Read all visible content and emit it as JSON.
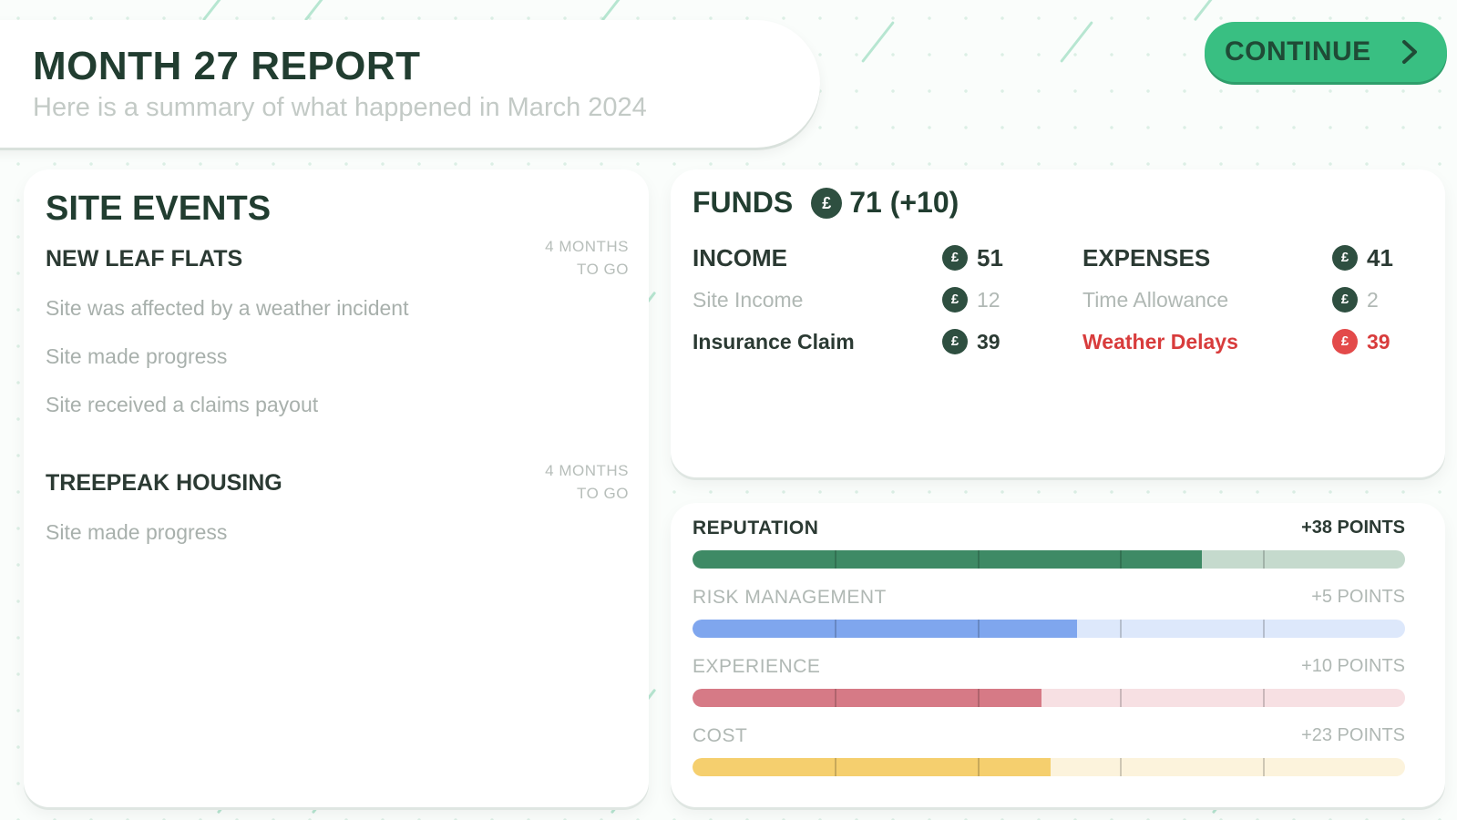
{
  "header": {
    "title": "MONTH 27 REPORT",
    "subtitle": "Here is a summary of what happened in March 2024"
  },
  "continue_button": {
    "label": "CONTINUE",
    "icon": "chevron-right-icon"
  },
  "site_events": {
    "title": "SITE EVENTS",
    "sites": [
      {
        "name": "NEW LEAF FLATS",
        "remaining_line1": "4 MONTHS",
        "remaining_line2": "TO GO",
        "events": [
          "Site was affected by a weather incident",
          "Site made progress",
          "Site received a claims payout"
        ]
      },
      {
        "name": "TREEPEAK HOUSING",
        "remaining_line1": "4 MONTHS",
        "remaining_line2": "TO GO",
        "events": [
          "Site made progress"
        ]
      }
    ]
  },
  "funds": {
    "label": "FUNDS",
    "coin_symbol": "£",
    "total": "71 (+10)",
    "income": {
      "label": "INCOME",
      "total": "51",
      "items": [
        {
          "label": "Site Income",
          "amount": "12"
        },
        {
          "label": "Insurance Claim",
          "amount": "39"
        }
      ]
    },
    "expenses": {
      "label": "EXPENSES",
      "total": "41",
      "items": [
        {
          "label": "Time Allowance",
          "amount": "2"
        },
        {
          "label": "Weather Delays",
          "amount": "39"
        }
      ]
    }
  },
  "stats": [
    {
      "name": "REPUTATION",
      "points": "+38 POINTS",
      "fill": 0.715,
      "color": "#3e8a65",
      "track": "#c5dacd",
      "emphasis": true
    },
    {
      "name": "RISK MANAGEMENT",
      "points": "+5 POINTS",
      "fill": 0.54,
      "color": "#7fa6ee",
      "track": "#dde8fb",
      "emphasis": false
    },
    {
      "name": "EXPERIENCE",
      "points": "+10 POINTS",
      "fill": 0.49,
      "color": "#d67a86",
      "track": "#f7e0e3",
      "emphasis": false
    },
    {
      "name": "COST",
      "points": "+23 POINTS",
      "fill": 0.503,
      "color": "#f5cf6e",
      "track": "#fcf3dc",
      "emphasis": false
    }
  ],
  "colors": {
    "accent": "#39bf82",
    "dark_green": "#213d30",
    "negative": "#d83c3c"
  }
}
